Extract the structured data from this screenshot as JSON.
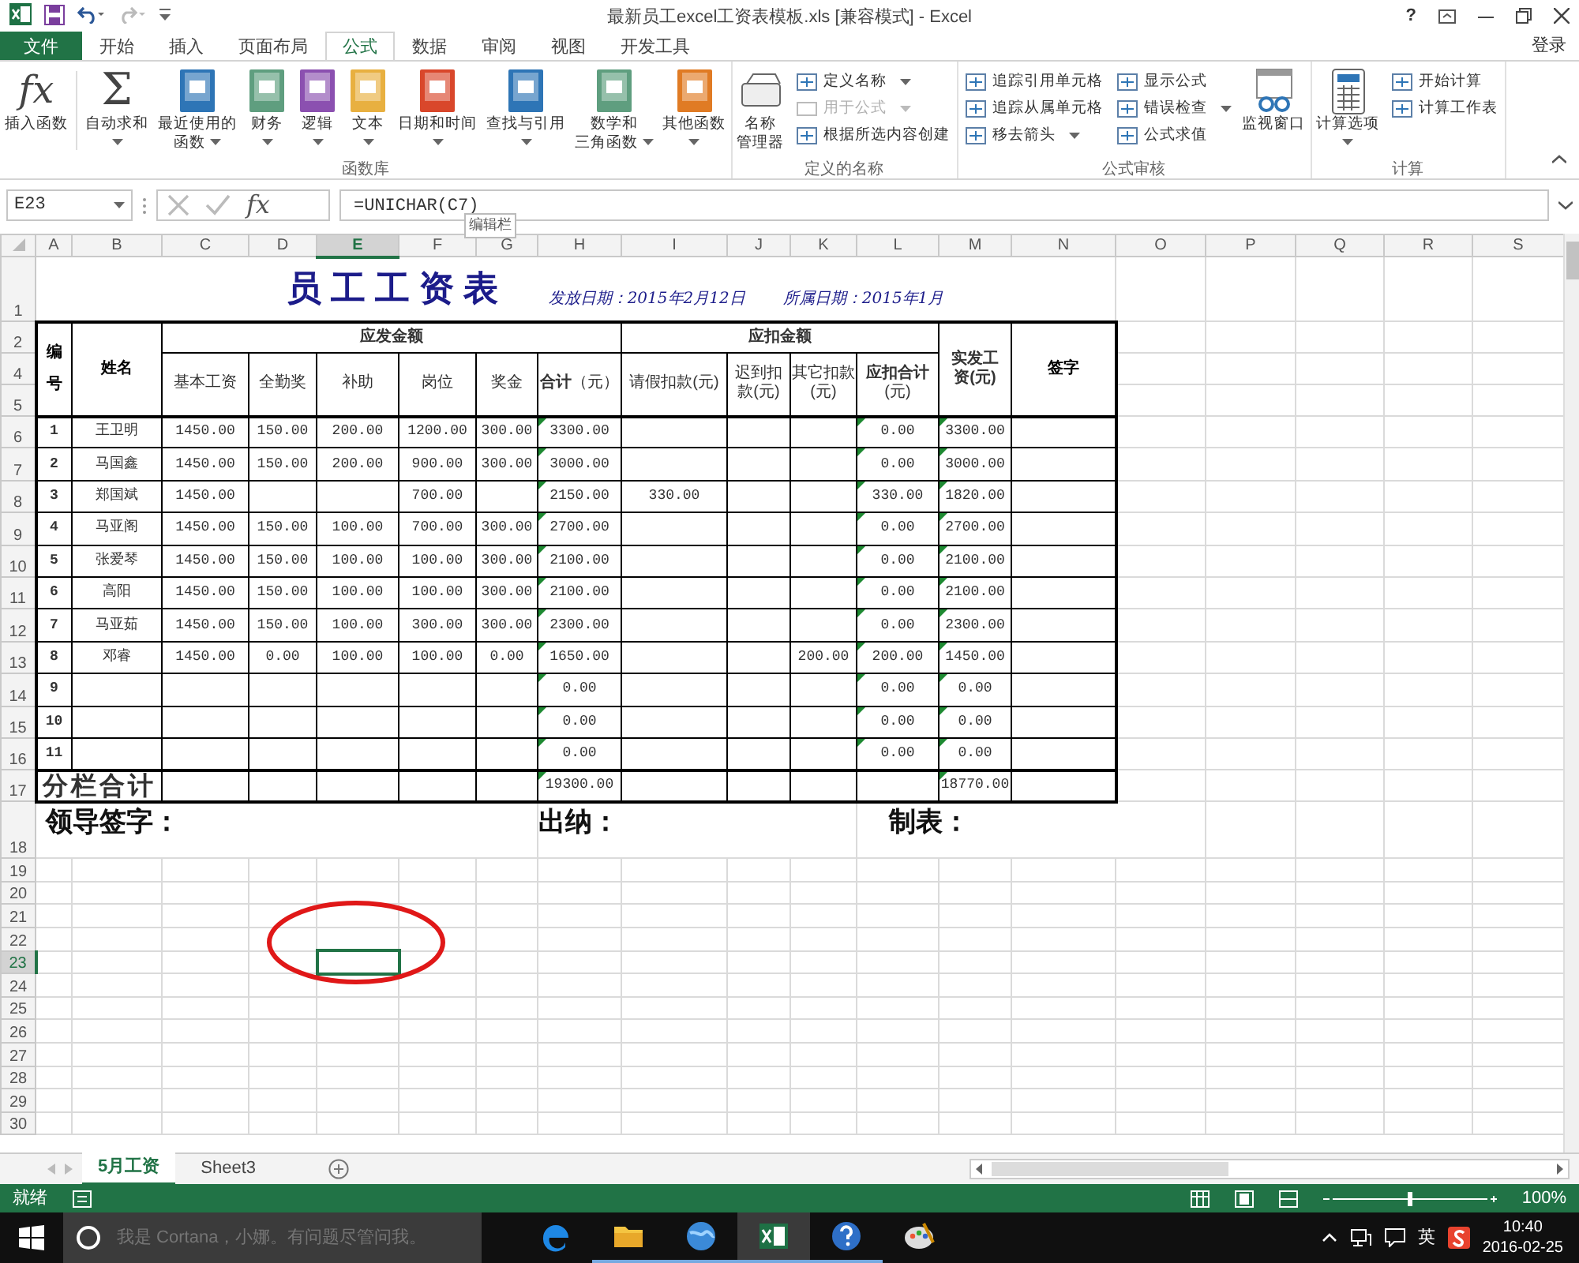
{
  "title_bar": {
    "title": "最新员工excel工资表模板.xls  [兼容模式] - Excel",
    "help": "?"
  },
  "ribbon": {
    "tabs": [
      {
        "label": "文件",
        "kind": "file",
        "selected": false
      },
      {
        "label": "开始",
        "kind": "tab",
        "selected": false
      },
      {
        "label": "插入",
        "kind": "tab",
        "selected": false
      },
      {
        "label": "页面布局",
        "kind": "tab",
        "selected": false
      },
      {
        "label": "公式",
        "kind": "tab",
        "selected": true
      },
      {
        "label": "数据",
        "kind": "tab",
        "selected": false
      },
      {
        "label": "审阅",
        "kind": "tab",
        "selected": false
      },
      {
        "label": "视图",
        "kind": "tab",
        "selected": false
      },
      {
        "label": "开发工具",
        "kind": "tab",
        "selected": false
      }
    ],
    "account": "登录",
    "groups": [
      {
        "label": "函数库",
        "items": [
          {
            "kind": "large",
            "glyph": "fx",
            "lines": [
              "插入函数"
            ],
            "dropdown": false
          },
          {
            "kind": "large",
            "glyph": "Σ",
            "lines": [
              "自动求和"
            ],
            "dropdown": true
          },
          {
            "kind": "large",
            "lines": [
              "最近使用的",
              "函数"
            ],
            "dropdown": true
          },
          {
            "kind": "large",
            "lines": [
              "财务"
            ],
            "dropdown": true
          },
          {
            "kind": "large",
            "lines": [
              "逻辑"
            ],
            "dropdown": true
          },
          {
            "kind": "large",
            "lines": [
              "文本"
            ],
            "dropdown": true
          },
          {
            "kind": "large",
            "lines": [
              "日期和时间"
            ],
            "dropdown": true
          },
          {
            "kind": "large",
            "lines": [
              "查找与引用"
            ],
            "dropdown": true
          },
          {
            "kind": "large",
            "lines": [
              "数学和",
              "三角函数"
            ],
            "dropdown": true
          },
          {
            "kind": "large",
            "lines": [
              "其他函数"
            ],
            "dropdown": true
          }
        ]
      },
      {
        "label": "定义的名称",
        "items": [
          {
            "kind": "large",
            "lines": [
              "名称",
              "管理器"
            ],
            "dropdown": false
          },
          {
            "kind": "small",
            "lines": [
              "定义名称"
            ],
            "dropdown": true,
            "disabled": false
          },
          {
            "kind": "small",
            "lines": [
              "用于公式"
            ],
            "dropdown": true,
            "disabled": true
          },
          {
            "kind": "small",
            "lines": [
              "根据所选内容创建"
            ],
            "dropdown": false,
            "disabled": false
          }
        ]
      },
      {
        "label": "公式审核",
        "items": [
          {
            "kind": "small",
            "lines": [
              "追踪引用单元格"
            ],
            "dropdown": false,
            "disabled": false
          },
          {
            "kind": "small",
            "lines": [
              "追踪从属单元格"
            ],
            "dropdown": false,
            "disabled": false
          },
          {
            "kind": "small",
            "lines": [
              "移去箭头"
            ],
            "dropdown": true,
            "disabled": false
          },
          {
            "kind": "small",
            "lines": [
              "显示公式"
            ],
            "dropdown": false,
            "disabled": false
          },
          {
            "kind": "small",
            "lines": [
              "错误检查"
            ],
            "dropdown": true,
            "disabled": false
          },
          {
            "kind": "small",
            "lines": [
              "公式求值"
            ],
            "dropdown": false,
            "disabled": false
          },
          {
            "kind": "large",
            "lines": [
              "监视窗口"
            ],
            "dropdown": false
          }
        ]
      },
      {
        "label": "计算",
        "items": [
          {
            "kind": "large",
            "lines": [
              "计算选项"
            ],
            "dropdown": true
          },
          {
            "kind": "small",
            "lines": [
              "开始计算"
            ],
            "dropdown": false,
            "disabled": false
          },
          {
            "kind": "small",
            "lines": [
              "计算工作表"
            ],
            "dropdown": false,
            "disabled": false
          }
        ]
      }
    ]
  },
  "formula_bar": {
    "name_box": "E23",
    "fx": "fx",
    "formula": "=UNICHAR(C7)",
    "tooltip": "编辑栏"
  },
  "sheet": {
    "columns": [
      {
        "label": "A",
        "selected": false
      },
      {
        "label": "B",
        "selected": false
      },
      {
        "label": "C",
        "selected": false
      },
      {
        "label": "D",
        "selected": false
      },
      {
        "label": "E",
        "selected": true
      },
      {
        "label": "F",
        "selected": false
      },
      {
        "label": "G",
        "selected": false
      },
      {
        "label": "H",
        "selected": false
      },
      {
        "label": "I",
        "selected": false
      },
      {
        "label": "J",
        "selected": false
      },
      {
        "label": "K",
        "selected": false
      },
      {
        "label": "L",
        "selected": false
      },
      {
        "label": "M",
        "selected": false
      },
      {
        "label": "N",
        "selected": false
      },
      {
        "label": "O",
        "selected": false
      },
      {
        "label": "P",
        "selected": false
      },
      {
        "label": "Q",
        "selected": false
      },
      {
        "label": "R",
        "selected": false
      },
      {
        "label": "S",
        "selected": false
      }
    ],
    "row_headers": [
      {
        "label": "1",
        "selected": false
      },
      {
        "label": "2",
        "selected": false
      },
      {
        "label": "4",
        "selected": false
      },
      {
        "label": "5",
        "selected": false
      },
      {
        "label": "6",
        "selected": false
      },
      {
        "label": "7",
        "selected": false
      },
      {
        "label": "8",
        "selected": false
      },
      {
        "label": "9",
        "selected": false
      },
      {
        "label": "10",
        "selected": false
      },
      {
        "label": "11",
        "selected": false
      },
      {
        "label": "12",
        "selected": false
      },
      {
        "label": "13",
        "selected": false
      },
      {
        "label": "14",
        "selected": false
      },
      {
        "label": "15",
        "selected": false
      },
      {
        "label": "16",
        "selected": false
      },
      {
        "label": "17",
        "selected": false
      },
      {
        "label": "18",
        "selected": false
      },
      {
        "label": "19",
        "selected": false
      },
      {
        "label": "20",
        "selected": false
      },
      {
        "label": "21",
        "selected": false
      },
      {
        "label": "22",
        "selected": false
      },
      {
        "label": "23",
        "selected": true
      },
      {
        "label": "24",
        "selected": false
      },
      {
        "label": "25",
        "selected": false
      },
      {
        "label": "26",
        "selected": false
      },
      {
        "label": "27",
        "selected": false
      },
      {
        "label": "28",
        "selected": false
      },
      {
        "label": "29",
        "selected": false
      },
      {
        "label": "30",
        "selected": false
      }
    ],
    "title": "员工工资表",
    "issue_date": "发放日期：2015年2月12日",
    "period": "所属日期：2015年1月",
    "head": {
      "no": "编号",
      "name": "姓名",
      "pay_group": "应发金额",
      "deduct_group": "应扣金额",
      "net": "实发工资(元)",
      "sign": "签字",
      "sub": [
        "基本工资",
        "全勤奖",
        "补助",
        "岗位",
        "奖金",
        "**合计**（元）",
        "请假扣款(元)",
        "迟到扣款(元)",
        "其它扣款(元)",
        "**应扣合计**(元)"
      ]
    },
    "rows": [
      {
        "cells": [
          "1",
          "王卫明",
          "1450.00",
          "150.00",
          "200.00",
          "1200.00",
          "300.00",
          {
            "text": "3300.00",
            "flag": true
          },
          null,
          null,
          null,
          {
            "text": "0.00",
            "flag": true
          },
          {
            "text": "3300.00",
            "flag": true
          },
          null
        ]
      },
      {
        "cells": [
          "2",
          "马国鑫",
          "1450.00",
          "150.00",
          "200.00",
          "900.00",
          "300.00",
          {
            "text": "3000.00",
            "flag": true
          },
          null,
          null,
          null,
          {
            "text": "0.00",
            "flag": true
          },
          {
            "text": "3000.00",
            "flag": true
          },
          null
        ]
      },
      {
        "cells": [
          "3",
          "郑国斌",
          "1450.00",
          null,
          null,
          "700.00",
          null,
          {
            "text": "2150.00",
            "flag": true
          },
          "330.00",
          null,
          null,
          {
            "text": "330.00",
            "flag": true
          },
          {
            "text": "1820.00",
            "flag": true
          },
          null
        ]
      },
      {
        "cells": [
          "4",
          "马亚阁",
          "1450.00",
          "150.00",
          "100.00",
          "700.00",
          "300.00",
          {
            "text": "2700.00",
            "flag": true
          },
          null,
          null,
          null,
          {
            "text": "0.00",
            "flag": true
          },
          {
            "text": "2700.00",
            "flag": true
          },
          null
        ]
      },
      {
        "cells": [
          "5",
          "张爱琴",
          "1450.00",
          "150.00",
          "100.00",
          "100.00",
          "300.00",
          {
            "text": "2100.00",
            "flag": true
          },
          null,
          null,
          null,
          {
            "text": "0.00",
            "flag": true
          },
          {
            "text": "2100.00",
            "flag": true
          },
          null
        ]
      },
      {
        "cells": [
          "6",
          "高阳",
          "1450.00",
          "150.00",
          "100.00",
          "100.00",
          "300.00",
          {
            "text": "2100.00",
            "flag": true
          },
          null,
          null,
          null,
          {
            "text": "0.00",
            "flag": true
          },
          {
            "text": "2100.00",
            "flag": true
          },
          null
        ]
      },
      {
        "cells": [
          "7",
          "马亚茹",
          "1450.00",
          "150.00",
          "100.00",
          "300.00",
          "300.00",
          {
            "text": "2300.00",
            "flag": true
          },
          null,
          null,
          null,
          {
            "text": "0.00",
            "flag": true
          },
          {
            "text": "2300.00",
            "flag": true
          },
          null
        ]
      },
      {
        "cells": [
          "8",
          "邓睿",
          "1450.00",
          "0.00",
          "100.00",
          "100.00",
          "0.00",
          {
            "text": "1650.00",
            "flag": true
          },
          null,
          null,
          "200.00",
          {
            "text": "200.00",
            "flag": true
          },
          {
            "text": "1450.00",
            "flag": true
          },
          null
        ]
      },
      {
        "cells": [
          "9",
          null,
          null,
          null,
          null,
          null,
          null,
          {
            "text": "0.00",
            "flag": true
          },
          null,
          null,
          null,
          {
            "text": "0.00",
            "flag": true
          },
          {
            "text": "0.00",
            "flag": true
          },
          null
        ]
      },
      {
        "cells": [
          "10",
          null,
          null,
          null,
          null,
          null,
          null,
          {
            "text": "0.00",
            "flag": true
          },
          null,
          null,
          null,
          {
            "text": "0.00",
            "flag": true
          },
          {
            "text": "0.00",
            "flag": true
          },
          null
        ]
      },
      {
        "cells": [
          "11",
          null,
          null,
          null,
          null,
          null,
          null,
          {
            "text": "0.00",
            "flag": true
          },
          null,
          null,
          null,
          {
            "text": "0.00",
            "flag": true
          },
          {
            "text": "0.00",
            "flag": true
          },
          null
        ]
      }
    ],
    "total": {
      "cells": [
        "分栏合计",
        null,
        null,
        null,
        null,
        null,
        null,
        {
          "text": "19300.00",
          "flag": true
        },
        null,
        null,
        null,
        null,
        {
          "text": "18770.00",
          "flag": true
        },
        null
      ]
    },
    "signatures": [
      "领导签字：",
      "出纳：",
      "制表："
    ]
  },
  "sheet_tabs": [
    {
      "label": "5月工资",
      "selected": true
    },
    {
      "label": "Sheet3",
      "selected": false
    }
  ],
  "status_bar": {
    "state": "就绪",
    "zoom": "100%",
    "zoom_slider": {
      "level": 0.5
    }
  },
  "taskbar": {
    "search_placeholder": "我是 Cortana，小娜。有问题尽管问我。",
    "ime": "英",
    "time": "10:40",
    "date": "2016-02-25"
  }
}
